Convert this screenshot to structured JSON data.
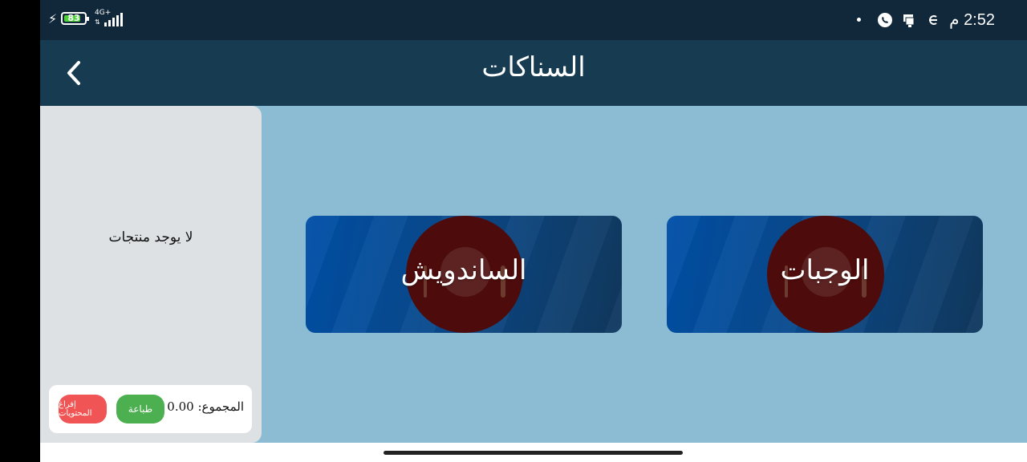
{
  "status_bar": {
    "battery_level": "83",
    "network_type": "4G+",
    "time": "2:52 م"
  },
  "app_bar": {
    "title": "السناكات"
  },
  "cart": {
    "empty_message": "لا يوجد منتجات",
    "total_label": "المجموع: 0.00",
    "print_label": "طباعة",
    "clear_label": "إفراغ المحتويات"
  },
  "categories": [
    {
      "label": "الساندويش"
    },
    {
      "label": "الوجبات"
    }
  ],
  "colors": {
    "status_bar": "#11283a",
    "app_bar": "#173b50",
    "content_bg": "#8cbcd4",
    "cart_bg": "#dde1e4",
    "print_button": "#4caf50",
    "clear_button": "#f15454",
    "category_tile": "#0050a8"
  },
  "icons": [
    "charging-bolt-icon",
    "battery-icon",
    "signal-bars-icon",
    "whatsapp-icon",
    "notification-icon",
    "sync-icon",
    "back-chevron-icon"
  ]
}
